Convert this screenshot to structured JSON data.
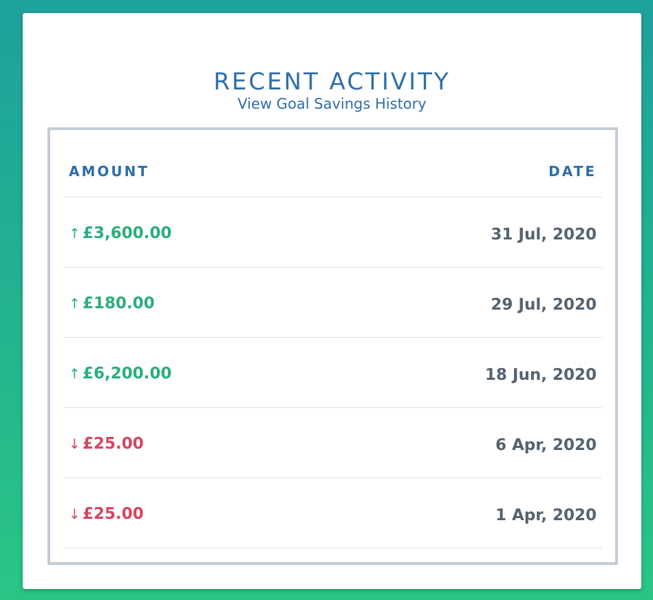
{
  "card": {
    "title": "RECENT ACTIVITY",
    "link_label": "View Goal Savings History"
  },
  "table": {
    "headers": {
      "amount": "AMOUNT",
      "date": "DATE"
    },
    "rows": [
      {
        "direction": "up",
        "arrow": "↑",
        "amount": "£3,600.00",
        "date": "31 Jul, 2020"
      },
      {
        "direction": "up",
        "arrow": "↑",
        "amount": "£180.00",
        "date": "29 Jul, 2020"
      },
      {
        "direction": "up",
        "arrow": "↑",
        "amount": "£6,200.00",
        "date": "18 Jun, 2020"
      },
      {
        "direction": "down",
        "arrow": "↓",
        "amount": "£25.00",
        "date": "6 Apr, 2020"
      },
      {
        "direction": "down",
        "arrow": "↓",
        "amount": "£25.00",
        "date": "1 Apr, 2020"
      }
    ]
  },
  "icons": {
    "up": "arrow-up-icon",
    "down": "arrow-down-icon"
  },
  "colors": {
    "accent": "#2d6eaa",
    "credit": "#2aae7c",
    "debit": "#d6455f",
    "date_text": "#55636f",
    "table_border": "#c2ccd6"
  }
}
